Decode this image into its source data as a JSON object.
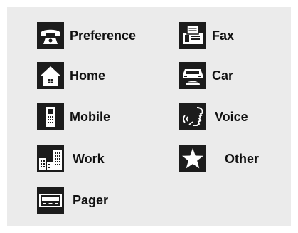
{
  "accent_color": "#1c1c1c",
  "background_color": "#ebebeb",
  "items": [
    {
      "label": "Preference",
      "icon": "telephone-icon"
    },
    {
      "label": "Fax",
      "icon": "fax-icon"
    },
    {
      "label": "Home",
      "icon": "house-icon"
    },
    {
      "label": "Car",
      "icon": "car-phone-icon"
    },
    {
      "label": "Mobile",
      "icon": "mobile-phone-icon"
    },
    {
      "label": "Voice",
      "icon": "voice-icon"
    },
    {
      "label": "Work",
      "icon": "office-buildings-icon"
    },
    {
      "label": "Other",
      "icon": "star-icon"
    },
    {
      "label": "Pager",
      "icon": "pager-icon"
    }
  ]
}
